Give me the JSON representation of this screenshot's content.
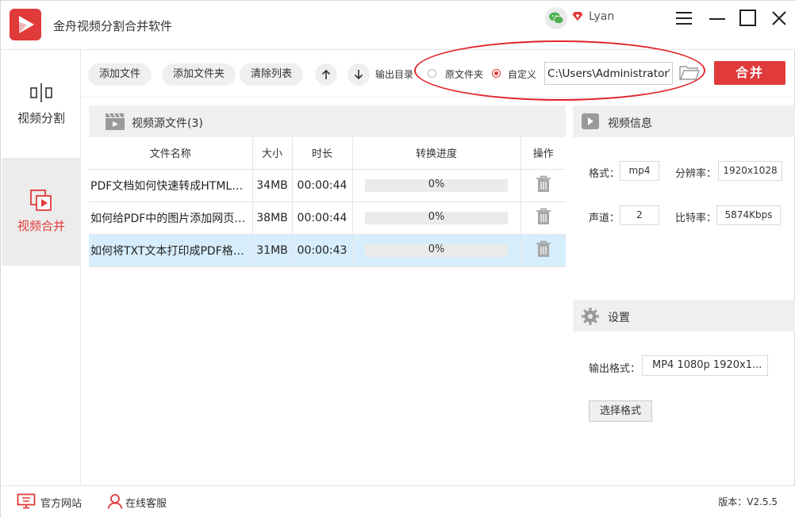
{
  "app": {
    "title": "金舟视频分割合并软件",
    "username": "Lyan",
    "accent_color": "#e03a3a"
  },
  "window_controls": [
    "menu-icon",
    "minimize-icon",
    "maximize-icon",
    "close-icon"
  ],
  "sidebar": {
    "items": [
      {
        "label": "视频分割",
        "icon": "split-icon",
        "active": false
      },
      {
        "label": "视频合并",
        "icon": "merge-icon",
        "active": true
      }
    ]
  },
  "toolbar": {
    "add_file": "添加文件",
    "add_folder": "添加文件夹",
    "clear_list": "清除列表",
    "output_dir_label": "输出目录",
    "radio_source": "原文件夹",
    "radio_custom": "自定义",
    "selected_radio": "自定义",
    "output_path": "C:\\Users\\Administrator\\",
    "merge_button": "合并"
  },
  "file_list": {
    "title": "视频源文件(3)",
    "columns": [
      "文件名称",
      "大小",
      "时长",
      "转换进度",
      "操作"
    ],
    "rows": [
      {
        "name": "PDF文档如何快速转成HTML网页...",
        "size": "34MB",
        "duration": "00:00:44",
        "progress": "0%",
        "progress_value": 0,
        "selected": false
      },
      {
        "name": "如何给PDF中的图片添加网页链接...",
        "size": "38MB",
        "duration": "00:00:44",
        "progress": "0%",
        "progress_value": 0,
        "selected": false
      },
      {
        "name": "如何将TXT文本打印成PDF格式...",
        "size": "31MB",
        "duration": "00:00:43",
        "progress": "0%",
        "progress_value": 0,
        "selected": true
      }
    ]
  },
  "video_info": {
    "title": "视频信息",
    "format_label": "格式：",
    "format_value": "mp4",
    "resolution_label": "分辨率：",
    "resolution_value": "1920x1028",
    "channel_label": "声道：",
    "channel_value": "2",
    "bitrate_label": "比特率：",
    "bitrate_value": "5874Kbps"
  },
  "settings": {
    "title": "设置",
    "output_format_label": "输出格式：",
    "output_format_value": "MP4 1080p 1920x1...",
    "choose_format": "选择格式"
  },
  "statusbar": {
    "website": "官方网站",
    "support": "在线客服",
    "version": "版本：V2.5.5"
  }
}
